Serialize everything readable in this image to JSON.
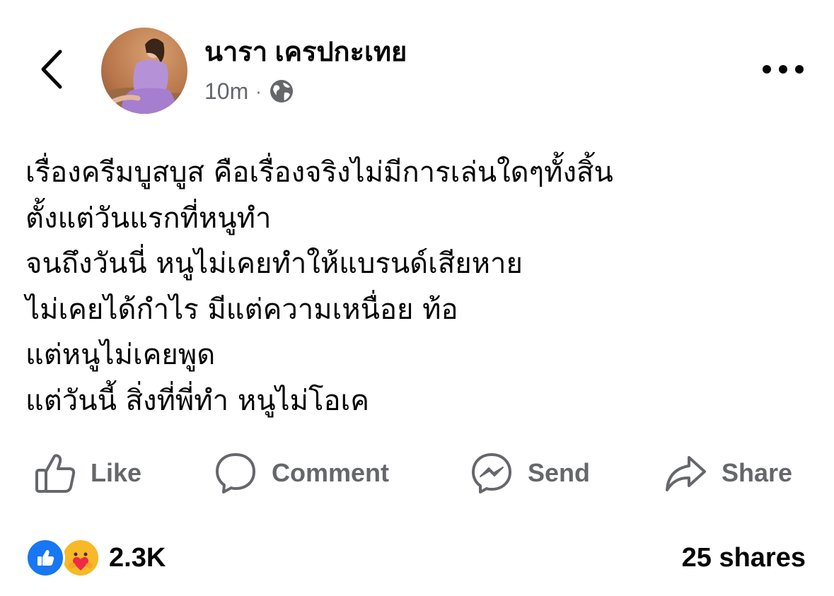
{
  "post": {
    "author": "นารา เครปกะเทย",
    "time": "10m",
    "separator": "·",
    "audience_icon": "globe-icon",
    "body_lines": [
      "เรื่องครีมบูสบูส คือเรื่องจริงไม่มีการเล่นใดๆทั้งสิ้น",
      "ตั้งแต่วันแรกที่หนูทำ",
      "จนถึงวันนี่ หนูไม่เคยทำให้แบรนด์เสียหาย",
      "ไม่เคยได้กำไร มีแต่ความเหนื่อย ท้อ",
      "แต่หนูไม่เคยพูด",
      "แต่วันนี้ สิ่งที่พี่ทำ หนูไม่โอเค"
    ]
  },
  "header": {
    "back_icon": "chevron-left-icon",
    "more_icon": "more-horizontal-icon"
  },
  "actions": {
    "like": "Like",
    "comment": "Comment",
    "send": "Send",
    "share": "Share"
  },
  "stats": {
    "reaction_icons": [
      "like-reaction-icon",
      "care-reaction-icon"
    ],
    "reactions": "2.3K",
    "shares": "25 shares"
  },
  "colors": {
    "text": "#050505",
    "secondary_text": "#65676b",
    "like_blue": "#1877f2",
    "care_yellow": "#f7b928"
  }
}
